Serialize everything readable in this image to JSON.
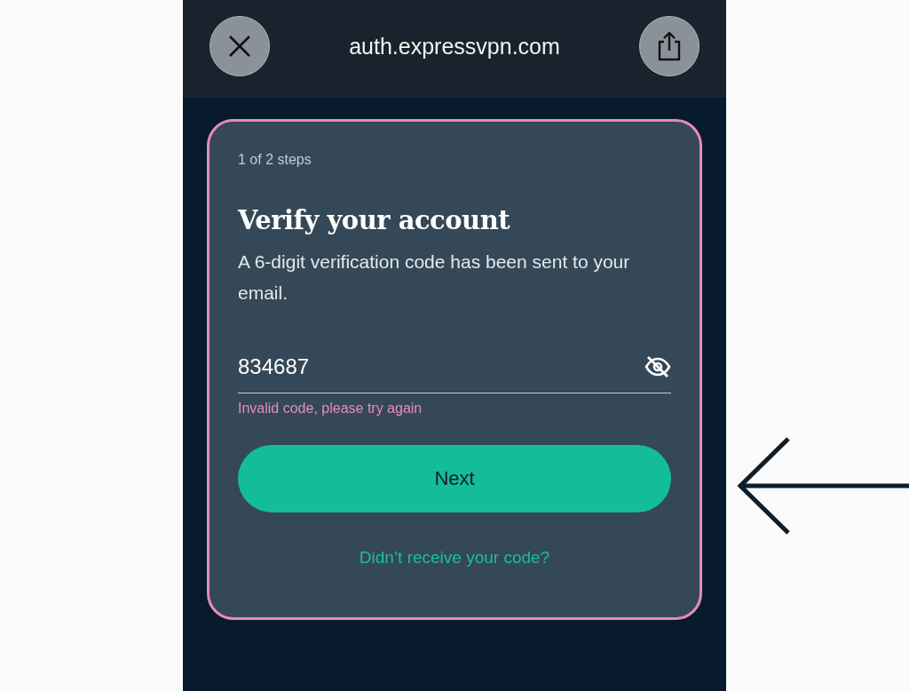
{
  "browser_bar": {
    "url": "auth.expressvpn.com"
  },
  "card": {
    "step": "1 of 2 steps",
    "title": "Verify your account",
    "description": "A 6-digit verification code has been sent to your email.",
    "code_field": {
      "value": "834687",
      "masked": false
    },
    "error": "Invalid code, please try again",
    "next_button": "Next",
    "resend_link": "Didn’t receive your code?"
  }
}
